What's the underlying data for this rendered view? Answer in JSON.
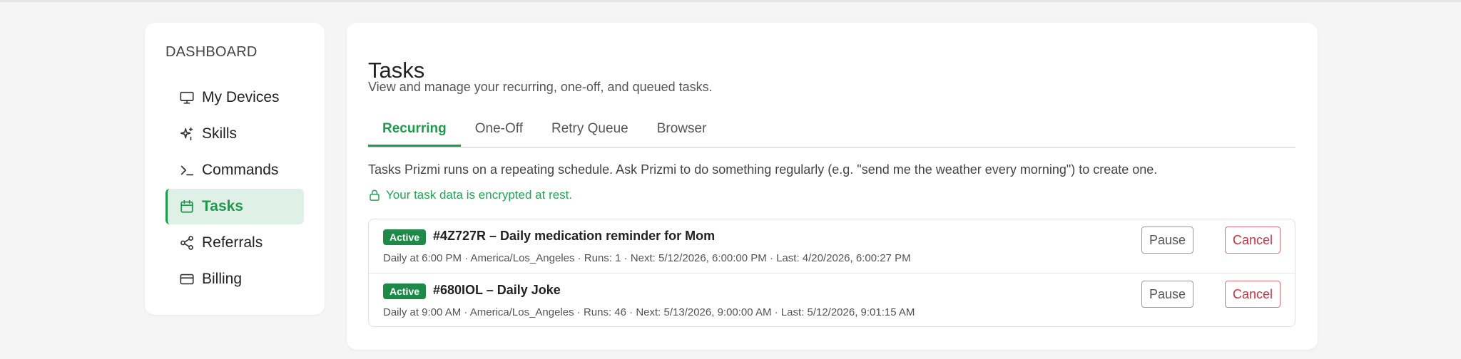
{
  "sidebar": {
    "heading": "DASHBOARD",
    "items": [
      {
        "label": "My Devices",
        "icon": "monitor-icon"
      },
      {
        "label": "Skills",
        "icon": "sparkle-icon"
      },
      {
        "label": "Commands",
        "icon": "terminal-icon"
      },
      {
        "label": "Tasks",
        "icon": "calendar-icon",
        "active": true
      },
      {
        "label": "Referrals",
        "icon": "share-icon"
      },
      {
        "label": "Billing",
        "icon": "credit-card-icon"
      }
    ]
  },
  "main": {
    "title": "Tasks",
    "subtitle": "View and manage your recurring, one-off, and queued tasks.",
    "tabs": [
      {
        "label": "Recurring",
        "active": true
      },
      {
        "label": "One-Off"
      },
      {
        "label": "Retry Queue"
      },
      {
        "label": "Browser"
      }
    ],
    "description": "Tasks Prizmi runs on a repeating schedule. Ask Prizmi to do something regularly (e.g. \"send me the weather every morning\") to create one.",
    "encrypted_note": "Your task data is encrypted at rest.",
    "tasks": [
      {
        "status": "Active",
        "title": "#4Z727R – Daily medication reminder for Mom",
        "meta": "Daily at 6:00 PM · America/Los_Angeles · Runs: 1 · Next: 5/12/2026, 6:00:00 PM · Last: 4/20/2026, 6:00:27 PM",
        "pause_label": "Pause",
        "cancel_label": "Cancel"
      },
      {
        "status": "Active",
        "title": "#680IOL – Daily Joke",
        "meta": "Daily at 9:00 AM · America/Los_Angeles · Runs: 46 · Next: 5/13/2026, 9:00:00 AM · Last: 5/12/2026, 9:01:15 AM",
        "pause_label": "Pause",
        "cancel_label": "Cancel"
      }
    ]
  },
  "colors": {
    "accent": "#1f9a4d",
    "accent_bg": "#dff1e6",
    "badge": "#1d8a48",
    "cancel": "#cc2f43"
  }
}
